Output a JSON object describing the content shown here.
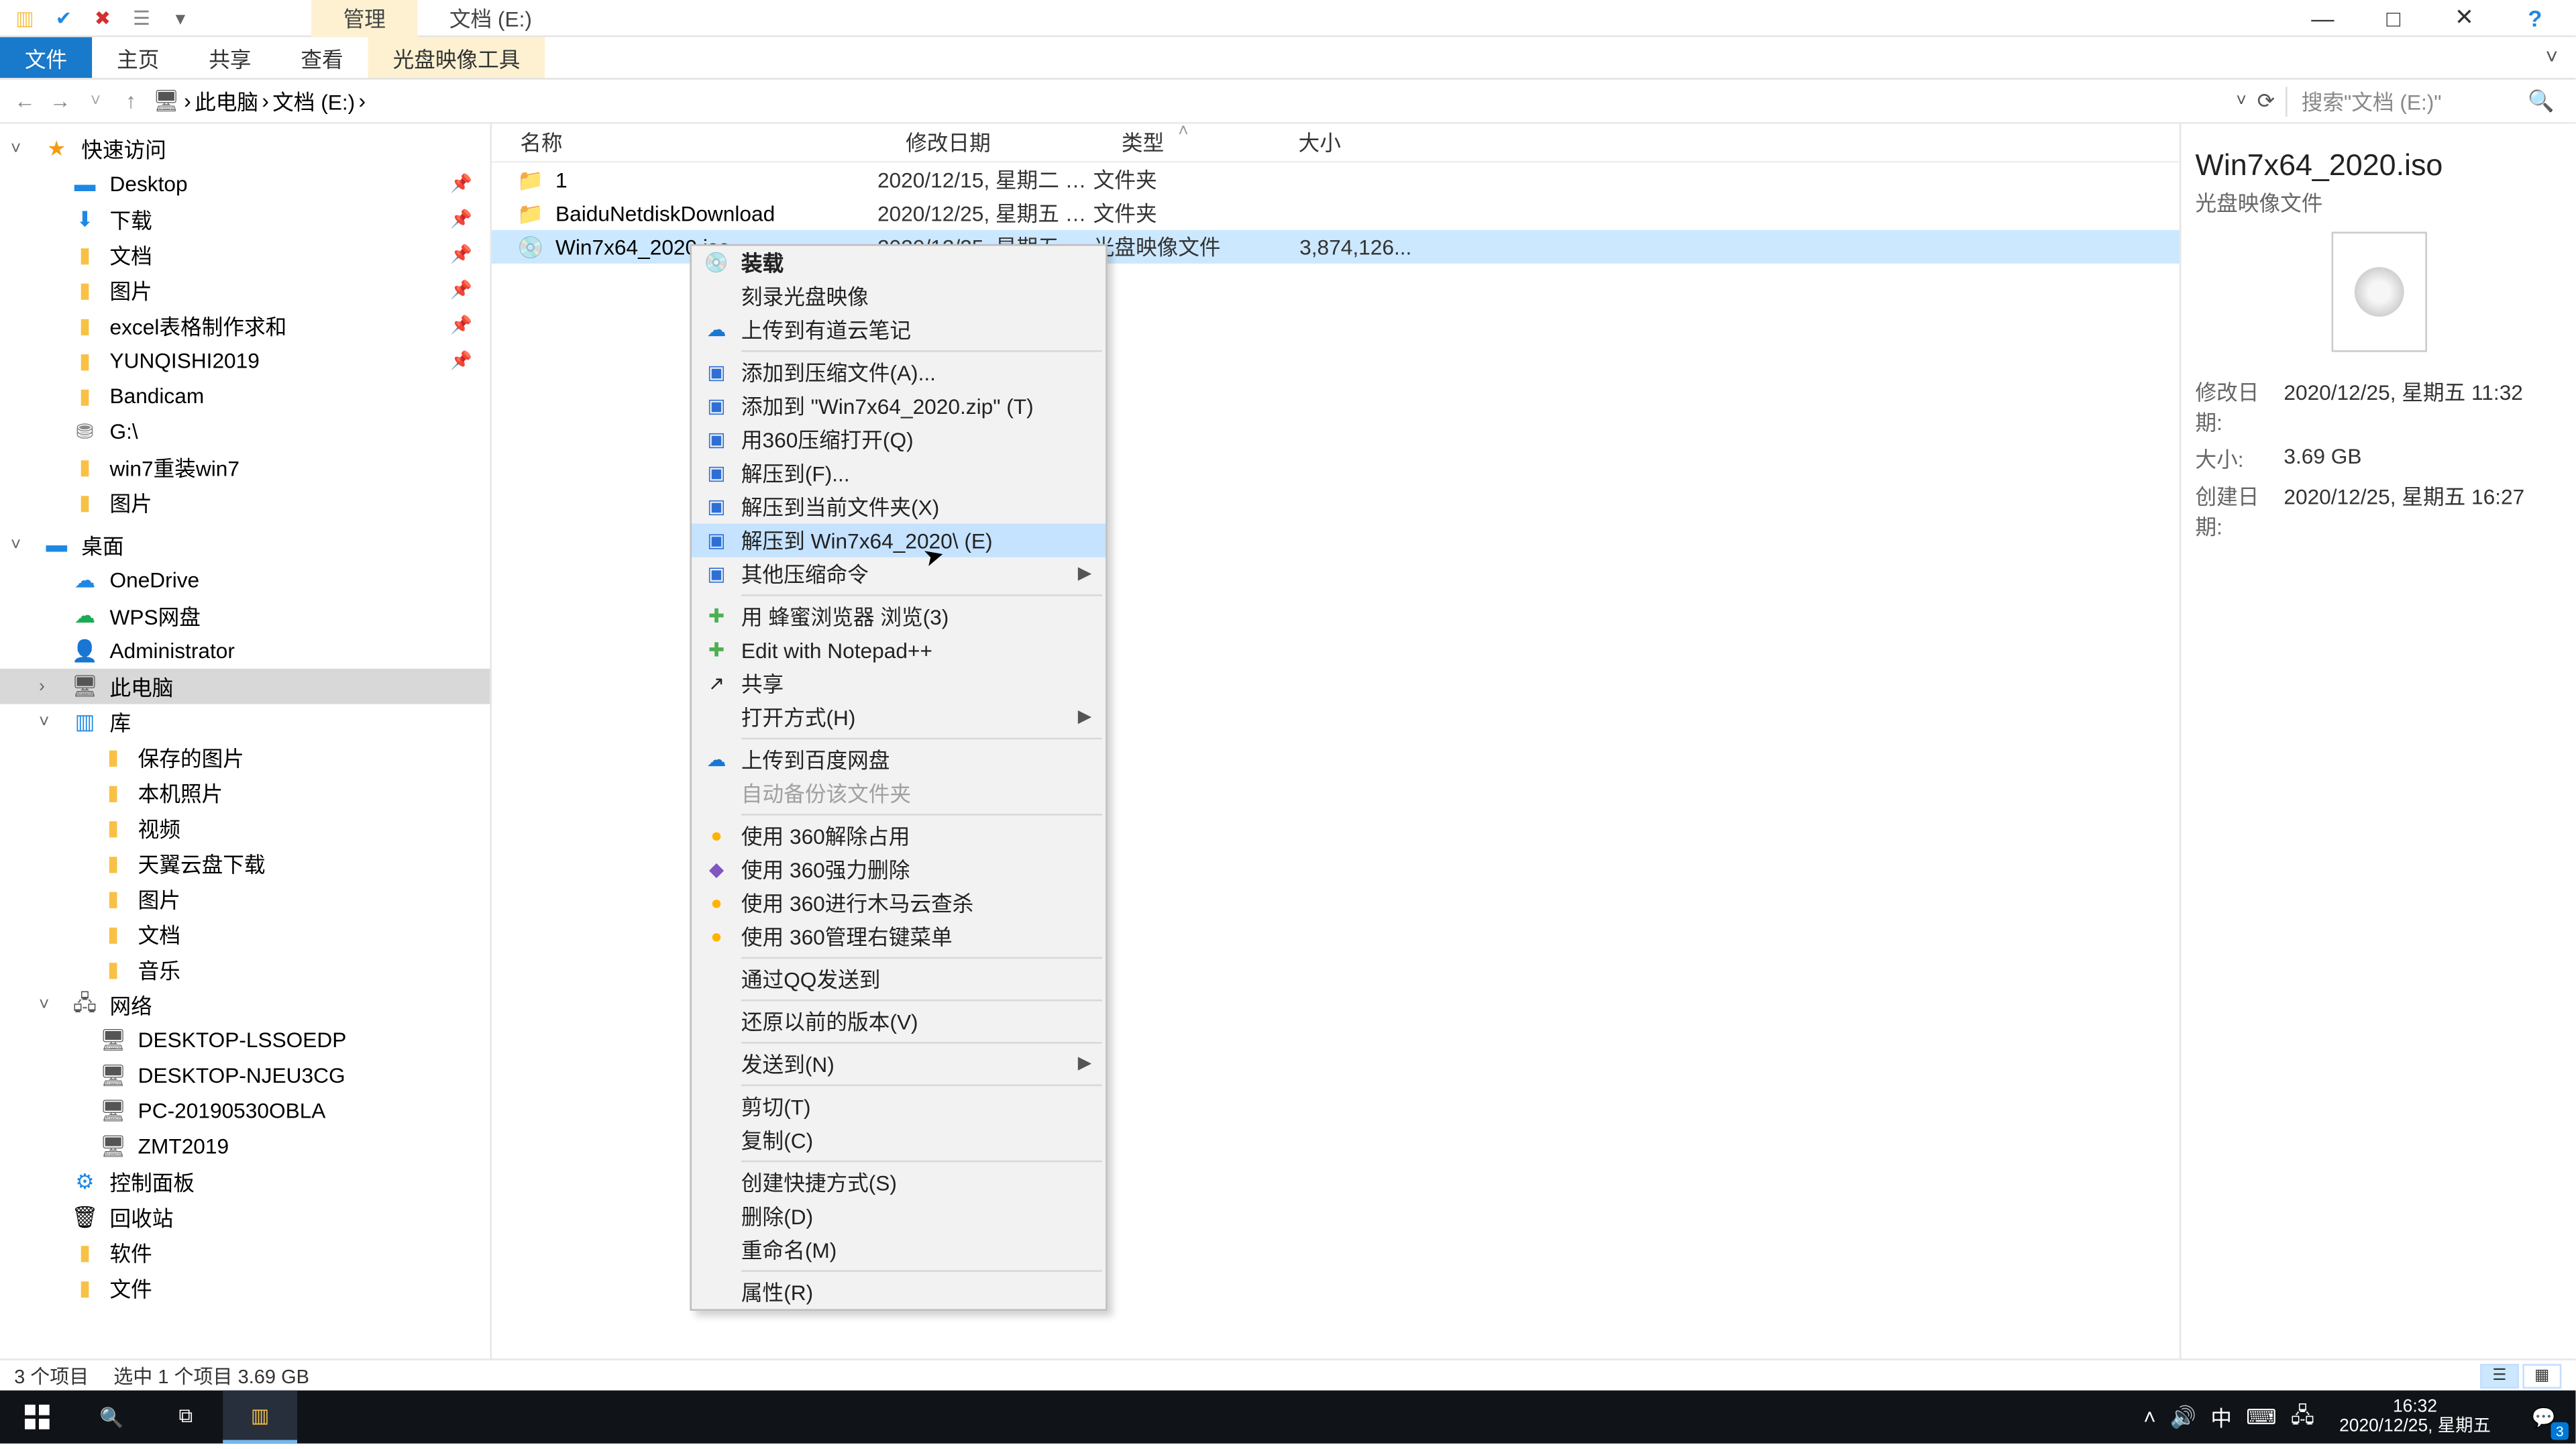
{
  "title_bar": {
    "context_tab": "管理",
    "window_title": "文档 (E:)",
    "minimize": "—",
    "maximize": "□",
    "close": "✕",
    "help": "?"
  },
  "ribbon": {
    "file": "文件",
    "home": "主页",
    "share": "共享",
    "view": "查看",
    "iso_tools": "光盘映像工具"
  },
  "address": {
    "back": "←",
    "forward": "→",
    "up": "↑",
    "root": "此电脑",
    "folder": "文档 (E:)",
    "refresh": "⟳",
    "search_placeholder": "搜索\"文档 (E:)\""
  },
  "tree": {
    "quick_access": "快速访问",
    "desktop": "Desktop",
    "downloads": "下载",
    "documents": "文档",
    "pictures": "图片",
    "excel": "excel表格制作求和",
    "yunqishi": "YUNQISHI2019",
    "bandicam": "Bandicam",
    "gdrive": "G:\\",
    "win7reinstall": "win7重装win7",
    "pics2": "图片",
    "desk_root": "桌面",
    "onedrive": "OneDrive",
    "wps": "WPS网盘",
    "admin": "Administrator",
    "thispc": "此电脑",
    "libraries": "库",
    "saved_pics": "保存的图片",
    "camera_roll": "本机照片",
    "videos": "视频",
    "tianyi": "天翼云盘下载",
    "pics3": "图片",
    "docs3": "文档",
    "music": "音乐",
    "network": "网络",
    "pc1": "DESKTOP-LSSOEDP",
    "pc2": "DESKTOP-NJEU3CG",
    "pc3": "PC-20190530OBLA",
    "pc4": "ZMT2019",
    "ctrl_panel": "控制面板",
    "recycle": "回收站",
    "software": "软件",
    "files": "文件"
  },
  "columns": {
    "name": "名称",
    "date": "修改日期",
    "type": "类型",
    "size": "大小"
  },
  "rows": [
    {
      "name": "1",
      "date": "2020/12/15, 星期二 1...",
      "type": "文件夹",
      "size": "",
      "icon": "folder"
    },
    {
      "name": "BaiduNetdiskDownload",
      "date": "2020/12/25, 星期五 1...",
      "type": "文件夹",
      "size": "",
      "icon": "folder"
    },
    {
      "name": "Win7x64_2020.iso",
      "date": "2020/12/25, 星期五 1...",
      "type": "光盘映像文件",
      "size": "3,874,126...",
      "icon": "iso",
      "selected": true
    }
  ],
  "details": {
    "title": "Win7x64_2020.iso",
    "subtitle": "光盘映像文件",
    "mod_k": "修改日期:",
    "mod_v": "2020/12/25, 星期五 11:32",
    "size_k": "大小:",
    "size_v": "3.69 GB",
    "create_k": "创建日期:",
    "create_v": "2020/12/25, 星期五 16:27"
  },
  "status": {
    "items": "3 个项目",
    "selected": "选中 1 个项目  3.69 GB"
  },
  "context_menu": [
    {
      "label": "装载",
      "icon": "disc",
      "bold": true
    },
    {
      "label": "刻录光盘映像"
    },
    {
      "label": "上传到有道云笔记",
      "icon": "blue"
    },
    {
      "sep": true
    },
    {
      "label": "添加到压缩文件(A)...",
      "icon": "compress"
    },
    {
      "label": "添加到 \"Win7x64_2020.zip\" (T)",
      "icon": "compress"
    },
    {
      "label": "用360压缩打开(Q)",
      "icon": "compress"
    },
    {
      "label": "解压到(F)...",
      "icon": "compress"
    },
    {
      "label": "解压到当前文件夹(X)",
      "icon": "compress"
    },
    {
      "label": "解压到 Win7x64_2020\\ (E)",
      "icon": "compress",
      "hover": true
    },
    {
      "label": "其他压缩命令",
      "icon": "compress",
      "submenu": true
    },
    {
      "sep": true
    },
    {
      "label": "用 蜂蜜浏览器 浏览(3)",
      "icon": "green"
    },
    {
      "label": "Edit with Notepad++",
      "icon": "green"
    },
    {
      "label": "共享",
      "icon": "share"
    },
    {
      "label": "打开方式(H)",
      "submenu": true
    },
    {
      "sep": true
    },
    {
      "label": "上传到百度网盘",
      "icon": "blue"
    },
    {
      "label": "自动备份该文件夹",
      "disabled": true
    },
    {
      "sep": true
    },
    {
      "label": "使用 360解除占用",
      "icon": "yellow360"
    },
    {
      "label": "使用 360强力删除",
      "icon": "purple"
    },
    {
      "label": "使用 360进行木马云查杀",
      "icon": "yellow360"
    },
    {
      "label": "使用 360管理右键菜单",
      "icon": "yellow360"
    },
    {
      "sep": true
    },
    {
      "label": "通过QQ发送到"
    },
    {
      "sep": true
    },
    {
      "label": "还原以前的版本(V)"
    },
    {
      "sep": true
    },
    {
      "label": "发送到(N)",
      "submenu": true
    },
    {
      "sep": true
    },
    {
      "label": "剪切(T)"
    },
    {
      "label": "复制(C)"
    },
    {
      "sep": true
    },
    {
      "label": "创建快捷方式(S)"
    },
    {
      "label": "删除(D)"
    },
    {
      "label": "重命名(M)"
    },
    {
      "sep": true
    },
    {
      "label": "属性(R)"
    }
  ],
  "taskbar": {
    "time": "16:32",
    "date": "2020/12/25, 星期五",
    "ime": "中",
    "notif_count": "3"
  }
}
